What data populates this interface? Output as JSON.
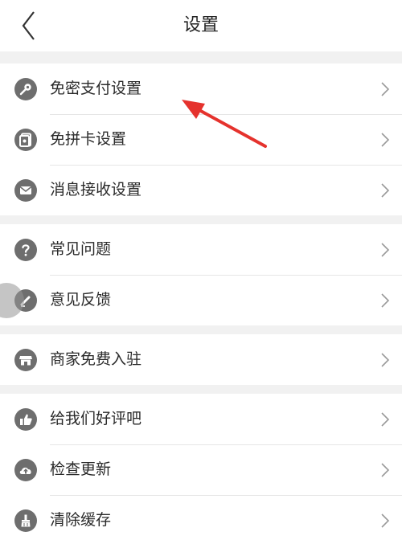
{
  "header": {
    "title": "设置",
    "back_icon": "chevron-left-icon"
  },
  "groups": [
    {
      "items": [
        {
          "label": "免密支付设置",
          "icon": "key-icon"
        },
        {
          "label": "免拼卡设置",
          "icon": "card-icon"
        },
        {
          "label": "消息接收设置",
          "icon": "mail-icon"
        }
      ]
    },
    {
      "items": [
        {
          "label": "常见问题",
          "icon": "question-icon"
        },
        {
          "label": "意见反馈",
          "icon": "pencil-icon"
        }
      ]
    },
    {
      "items": [
        {
          "label": "商家免费入驻",
          "icon": "store-icon"
        }
      ]
    },
    {
      "items": [
        {
          "label": "给我们好评吧",
          "icon": "thumbs-up-icon"
        },
        {
          "label": "检查更新",
          "icon": "cloud-upload-icon"
        },
        {
          "label": "清除缓存",
          "icon": "broom-icon"
        }
      ]
    }
  ],
  "colors": {
    "background": "#f1f1f1",
    "icon": "#6e6e6e",
    "annotation_arrow": "#e5322d"
  }
}
